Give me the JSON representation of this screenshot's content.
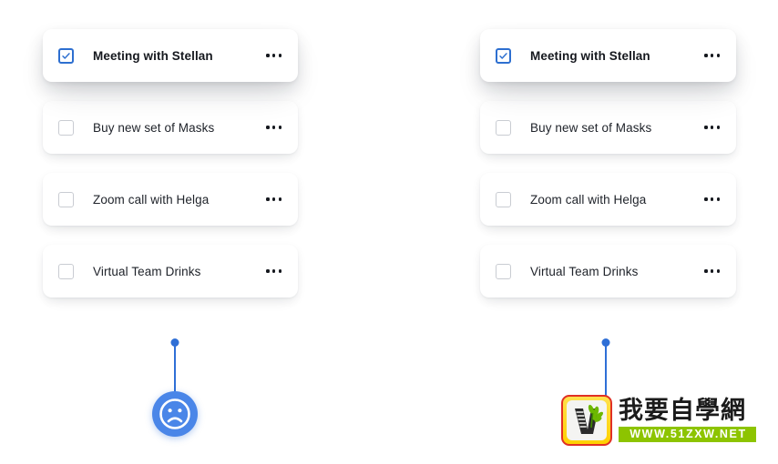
{
  "page": {
    "background_color": "#ffffff",
    "accent_color": "#2f6fd6",
    "card_background": "#ffffff",
    "text_color": "#20242b"
  },
  "columns": [
    {
      "id": "left",
      "name": "task-list-left",
      "tasks": [
        {
          "label": "Meeting with Stellan",
          "checked": true,
          "bold": true,
          "state": "lifted"
        },
        {
          "label": "Buy new set of Masks",
          "checked": false,
          "bold": false,
          "state": "resting"
        },
        {
          "label": "Zoom call with Helga",
          "checked": false,
          "bold": false,
          "state": "resting"
        },
        {
          "label": "Virtual Team Drinks",
          "checked": false,
          "bold": false,
          "state": "resting"
        }
      ]
    },
    {
      "id": "right",
      "name": "task-list-right",
      "tasks": [
        {
          "label": "Meeting with Stellan",
          "checked": true,
          "bold": true,
          "state": "lifted"
        },
        {
          "label": "Buy new set of Masks",
          "checked": false,
          "bold": false,
          "state": "resting"
        },
        {
          "label": "Zoom call with Helga",
          "checked": false,
          "bold": false,
          "state": "resting"
        },
        {
          "label": "Virtual Team Drinks",
          "checked": false,
          "bold": false,
          "state": "resting"
        }
      ]
    }
  ],
  "pins": [
    {
      "id": "left",
      "icon": "sad-face-emoji",
      "color": "#4a86e8",
      "has_bubble": true
    },
    {
      "id": "right",
      "icon": "pin-dot",
      "color": "#2f6fd6",
      "has_bubble": false
    }
  ],
  "watermark": {
    "badge_icon": "ladder-plant-v-logo",
    "title": "我要自學網",
    "url": "WWW.51ZXW.NET",
    "border_color": "#e03024",
    "badge_color": "#ffd000",
    "url_background": "#8dc400"
  },
  "icons": {
    "check": "check-mark",
    "more": "ellipsis-horizontal"
  }
}
